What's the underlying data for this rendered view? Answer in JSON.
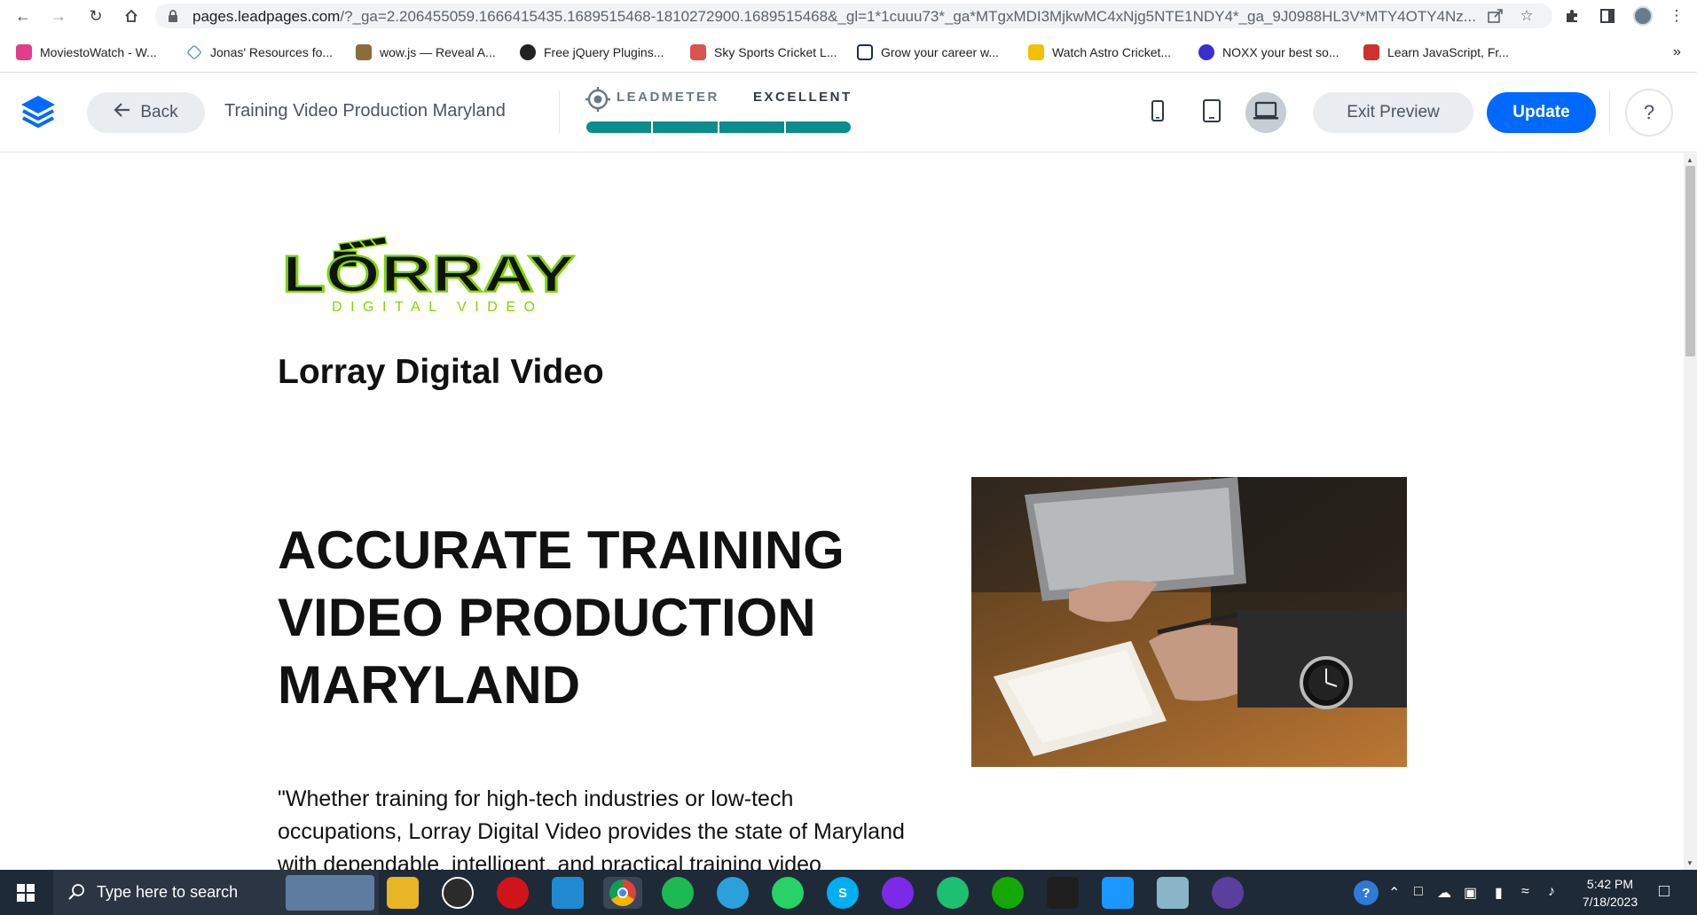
{
  "browser": {
    "url_host": "pages.leadpages.com",
    "url_rest": "/?_ga=2.206455059.1666415435.1689515468-1810272900.1689515468&_gl=1*1cuuu73*_ga*MTgxMDI3MjkwMC4xNjg5NTE1NDY4*_ga_9J0988HL3V*MTY4OTY4Nz...",
    "bookmarks": [
      {
        "label": "MoviestoWatch - W...",
        "color": "#e23c8b"
      },
      {
        "label": "Jonas' Resources fo...",
        "color": "#4a9ad4"
      },
      {
        "label": "wow.js — Reveal A...",
        "color": "#8a6d3b"
      },
      {
        "label": "Free jQuery Plugins...",
        "color": "#222222"
      },
      {
        "label": "Sky Sports Cricket L...",
        "color": "#d9534f"
      },
      {
        "label": "Grow your career w...",
        "color": "#1d2b5a"
      },
      {
        "label": "Watch Astro Cricket...",
        "color": "#f2c200"
      },
      {
        "label": "NOXX your best so...",
        "color": "#3b2ed0"
      },
      {
        "label": "Learn JavaScript, Fr...",
        "color": "#d0312d"
      }
    ]
  },
  "leadpages": {
    "back_label": "Back",
    "page_title": "Training Video Production Maryland",
    "leadmeter_label": "LEADMETER",
    "leadmeter_score": "EXCELLENT",
    "leadmeter_level": 1.0,
    "exit_label": "Exit Preview",
    "update_label": "Update",
    "help_label": "?",
    "accent_color": "#0069ff",
    "meter_color": "#0d8c8e"
  },
  "page": {
    "logo_word": "LORRAY",
    "logo_tagline": "DIGITAL VIDEO",
    "brand_name": "Lorray Digital Video",
    "headline": "ACCURATE TRAINING VIDEO PRODUCTION MARYLAND",
    "intro": "\"Whether training for high-tech industries or low-tech occupations, Lorray Digital Video provides the state of Maryland with dependable, intelligent, and practical training video"
  },
  "taskbar": {
    "search_placeholder": "Type here to search",
    "time": "5:42 PM",
    "date": "7/18/2023"
  }
}
